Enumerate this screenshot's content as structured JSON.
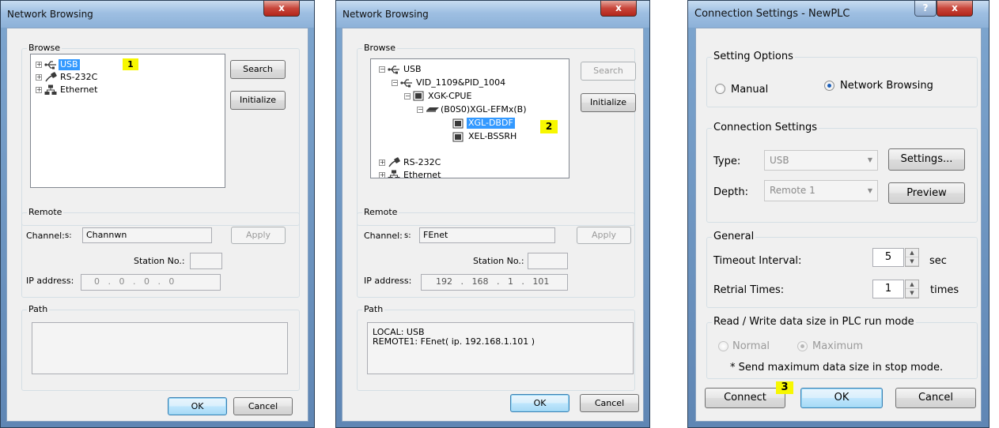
{
  "dialog1": {
    "title": "Network Browsing",
    "close": "x",
    "browse_label": "Browse",
    "tree": [
      {
        "label": "USB",
        "selected": true
      },
      {
        "label": "RS-232C"
      },
      {
        "label": "Ethernet"
      }
    ],
    "marker": "1",
    "search": "Search",
    "initialize": "Initialize",
    "remote_label": "Remote",
    "channel_label": "Channel:",
    "channel_prefix": "s:",
    "channel_value": "Channwn",
    "apply": "Apply",
    "station_label": "Station No.:",
    "station_value": "",
    "ip_label": "IP address:",
    "ip_value": "0   .   0   .   0   .   0",
    "path_label": "Path",
    "path_line1": "",
    "path_line2": "",
    "ok": "OK",
    "cancel": "Cancel"
  },
  "dialog2": {
    "title": "Network Browsing",
    "close": "x",
    "browse_label": "Browse",
    "tree": [
      {
        "label": "USB"
      },
      {
        "label": "VID_1109&PID_1004"
      },
      {
        "label": "XGK-CPUE"
      },
      {
        "label": "(B0S0)XGL-EFMx(B)"
      },
      {
        "label": "XGL-DBDF",
        "selected": true
      },
      {
        "label": "XEL-BSSRH"
      },
      {
        "label": "RS-232C"
      },
      {
        "label": "Ethernet"
      }
    ],
    "marker": "2",
    "search": "Search",
    "initialize": "Initialize",
    "remote_label": "Remote",
    "channel_label": "Channel:",
    "channel_prefix": "s:",
    "channel_value": "FEnet",
    "apply": "Apply",
    "station_label": "Station No.:",
    "station_value": "",
    "ip_label": "IP address:",
    "ip_value": "192   .   168   .   1   .   101",
    "path_label": "Path",
    "path_line1": "LOCAL: USB",
    "path_line2": "REMOTE1: FEnet( ip. 192.168.1.101 )",
    "ok": "OK",
    "cancel": "Cancel"
  },
  "dialog3": {
    "title": "Connection Settings - NewPLC",
    "help": "?",
    "close": "x",
    "setting_options_label": "Setting Options",
    "manual": "Manual",
    "manual_selected": false,
    "network_browsing": "Network Browsing",
    "network_browsing_selected": true,
    "connection_settings_label": "Connection Settings",
    "type_label": "Type:",
    "type_value": "USB",
    "settings_button": "Settings...",
    "depth_label": "Depth:",
    "depth_value": "Remote 1",
    "preview_button": "Preview",
    "general_label": "General",
    "timeout_label": "Timeout Interval:",
    "timeout_value": "5",
    "timeout_unit": "sec",
    "retrial_label": "Retrial Times:",
    "retrial_value": "1",
    "retrial_unit": "times",
    "rw_label": "Read / Write data size in PLC run mode",
    "normal": "Normal",
    "normal_selected": false,
    "maximum": "Maximum",
    "maximum_selected": true,
    "note": "* Send maximum data size in stop mode.",
    "marker": "3",
    "connect": "Connect",
    "ok": "OK",
    "cancel": "Cancel"
  }
}
